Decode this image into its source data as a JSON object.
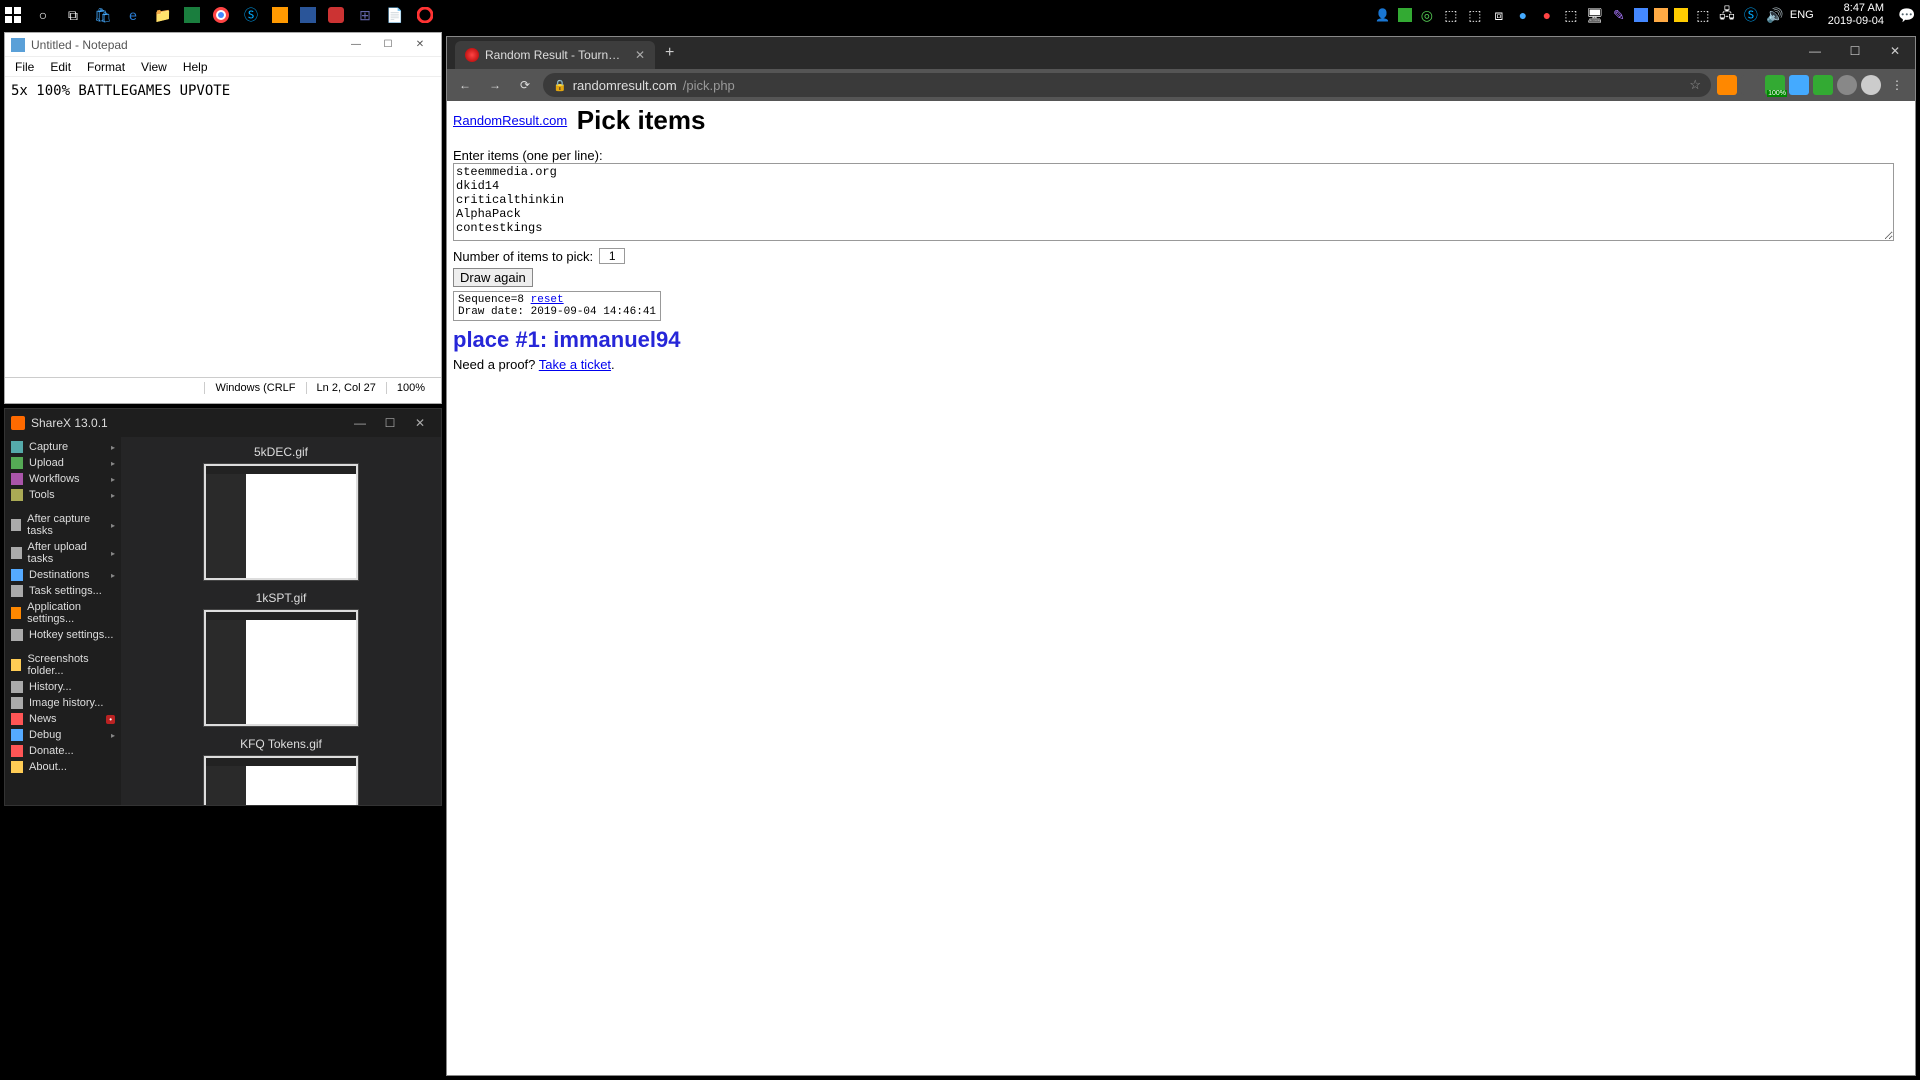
{
  "taskbar": {
    "lang": "ENG",
    "time": "8:47 AM",
    "date": "2019-09-04",
    "left_icons": [
      "start",
      "cortana",
      "taskview",
      "store",
      "edge",
      "explorer",
      "excel",
      "chrome",
      "skype",
      "outlook",
      "word",
      "app1",
      "teams",
      "notepad",
      "opera"
    ],
    "tray_icons": [
      "people",
      "app",
      "circ",
      "net",
      "db",
      "cloud",
      "rec",
      "dot",
      "mon",
      "clip",
      "leaf",
      "win",
      "cal",
      "note",
      "net2",
      "skype2",
      "vol"
    ]
  },
  "notepad": {
    "title": "Untitled - Notepad",
    "menu": [
      "File",
      "Edit",
      "Format",
      "View",
      "Help"
    ],
    "content": "5x 100% BATTLEGAMES UPVOTE",
    "status": {
      "encoding": "Windows (CRLF",
      "pos": "Ln 2, Col 27",
      "zoom": "100%"
    }
  },
  "sharex": {
    "title": "ShareX 13.0.1",
    "sidebar": [
      {
        "label": "Capture",
        "arrow": true,
        "color": "#5aa"
      },
      {
        "label": "Upload",
        "arrow": true,
        "color": "#5a5"
      },
      {
        "label": "Workflows",
        "arrow": true,
        "color": "#a5a"
      },
      {
        "label": "Tools",
        "arrow": true,
        "color": "#aa5"
      }
    ],
    "sidebar2": [
      {
        "label": "After capture tasks",
        "arrow": true,
        "color": "#aaa"
      },
      {
        "label": "After upload tasks",
        "arrow": true,
        "color": "#aaa"
      },
      {
        "label": "Destinations",
        "arrow": true,
        "color": "#5af"
      },
      {
        "label": "Task settings...",
        "color": "#aaa"
      },
      {
        "label": "Application settings...",
        "color": "#f80"
      },
      {
        "label": "Hotkey settings...",
        "color": "#aaa"
      }
    ],
    "sidebar3": [
      {
        "label": "Screenshots folder...",
        "color": "#fc5"
      },
      {
        "label": "History...",
        "color": "#aaa"
      },
      {
        "label": "Image history...",
        "color": "#aaa"
      },
      {
        "label": "News",
        "badge": "•",
        "color": "#f55"
      },
      {
        "label": "Debug",
        "arrow": true,
        "color": "#5af"
      },
      {
        "label": "Donate...",
        "color": "#f55"
      },
      {
        "label": "About...",
        "color": "#fc5"
      }
    ],
    "thumbs": [
      "5kDEC.gif",
      "1kSPT.gif",
      "KFQ Tokens.gif"
    ]
  },
  "chrome": {
    "tab_title": "Random Result - Tournament dra",
    "url_host": "randomresult.com",
    "url_path": "/pick.php",
    "nav": {
      "back": "←",
      "forward": "→",
      "reload": "⟳"
    }
  },
  "page": {
    "site_link": "RandomResult.com",
    "title": "Pick items",
    "items_label": "Enter items (one per line):",
    "items_text": "steemmedia.org\ndkid14\ncriticalthinkin\nAlphaPack\ncontestkings",
    "num_label": "Number of items to pick:",
    "num_value": "1",
    "draw_button": "Draw again",
    "sequence_label": "Sequence=8",
    "reset_link": "reset",
    "draw_date": "Draw date: 2019-09-04 14:46:41",
    "result": "place #1: immanuel94",
    "proof_text": "Need a proof? ",
    "proof_link": "Take a ticket",
    "proof_after": "."
  }
}
